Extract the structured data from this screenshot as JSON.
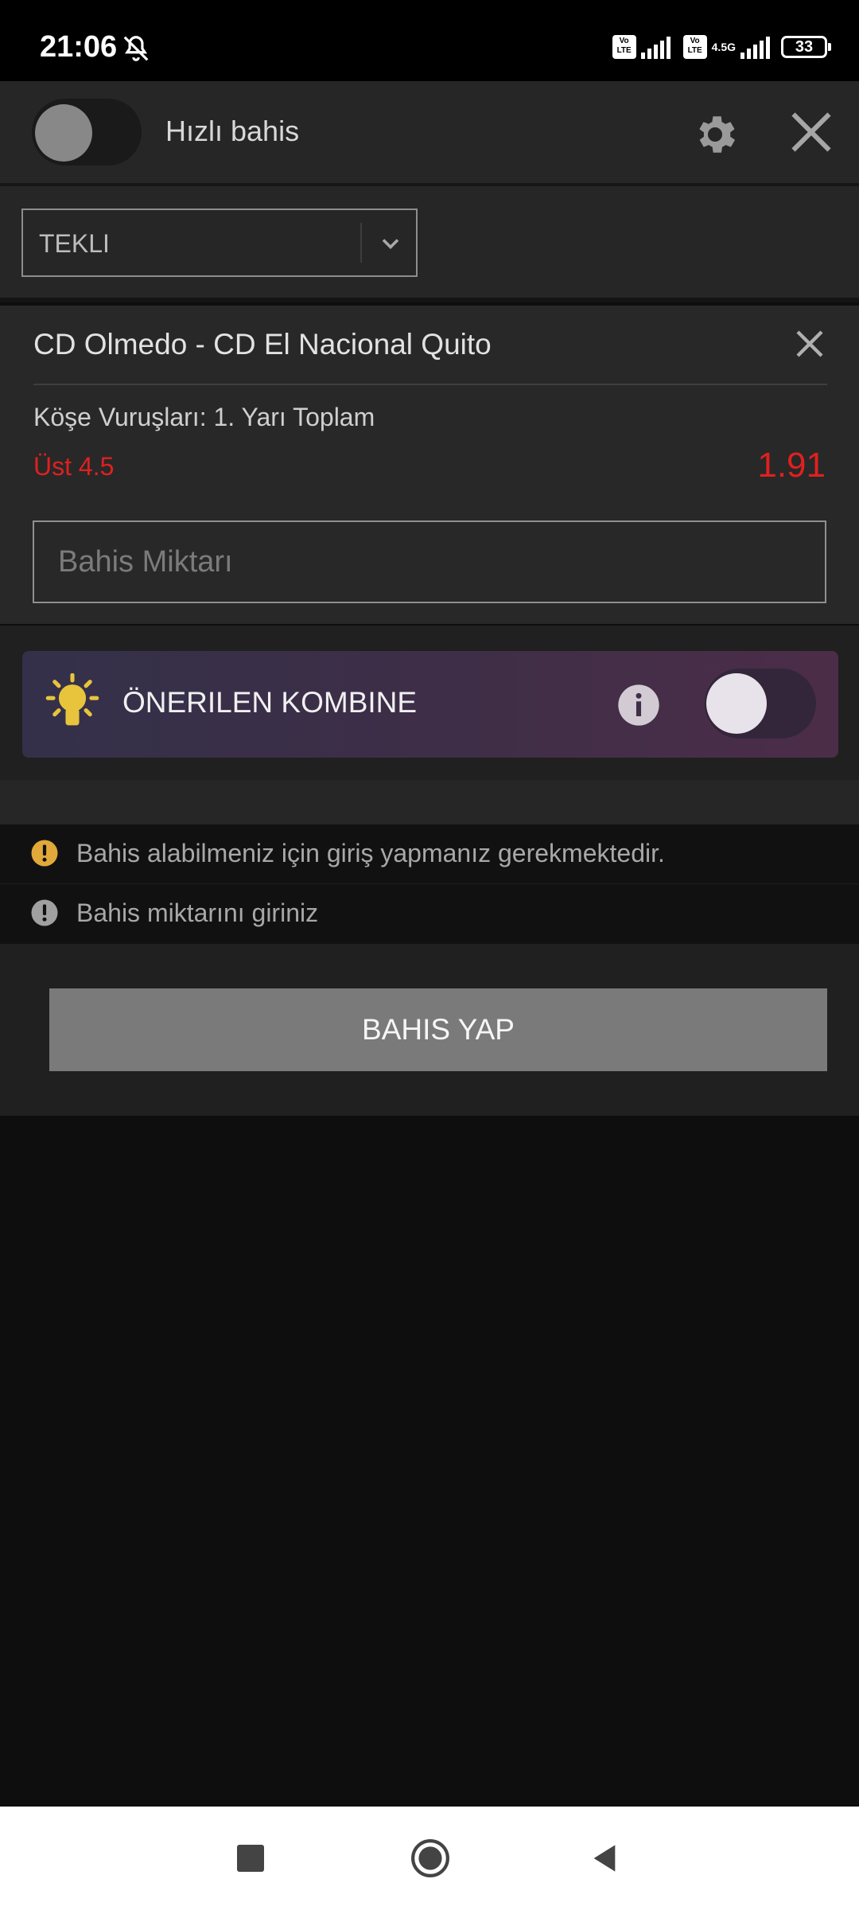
{
  "status_bar": {
    "time": "21:06",
    "network_label": "4.5G",
    "battery": "33",
    "volte_label": "Vo LTE"
  },
  "header": {
    "quick_bet_label": "Hızlı bahis",
    "quick_bet_enabled": false
  },
  "bet_type": {
    "selected": "TEKLI"
  },
  "bet_card": {
    "match": "CD Olmedo - CD El Nacional Quito",
    "market": "Köşe Vuruşları: 1. Yarı Toplam",
    "selection": "Üst 4.5",
    "odds": "1.91",
    "stake_placeholder": "Bahis Miktarı",
    "stake_value": ""
  },
  "promo": {
    "label": "ÖNERILEN KOMBINE",
    "enabled": false
  },
  "messages": [
    {
      "text": "Bahis alabilmeniz için giriş yapmanız gerekmektedir.",
      "color": "#e0a93a"
    },
    {
      "text": "Bahis miktarını giriniz",
      "color": "#a0a0a0"
    }
  ],
  "actions": {
    "place_bet_label": "BAHIS YAP"
  },
  "colors": {
    "accent_red": "#e02020",
    "bulb_yellow": "#e8c43c",
    "warning_amber": "#e0a93a"
  }
}
